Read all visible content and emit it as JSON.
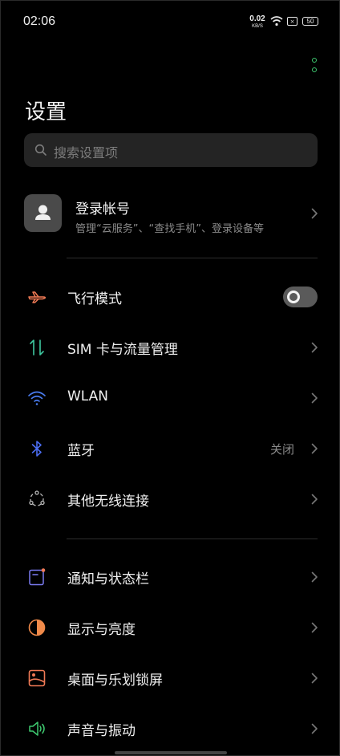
{
  "status_bar": {
    "time": "02:06",
    "net_speed": "0.02",
    "net_unit": "KB/S",
    "sim_label": "×",
    "battery": "50"
  },
  "header": {
    "title": "设置"
  },
  "search": {
    "placeholder": "搜索设置项"
  },
  "account": {
    "title": "登录帐号",
    "subtitle": "管理“云服务”、“查找手机”、登录设备等"
  },
  "sections": [
    [
      {
        "label": "飞行模式",
        "icon": "airplane-icon",
        "control": "toggle",
        "toggle_on": false
      },
      {
        "label": "SIM 卡与流量管理",
        "icon": "sim-data-icon",
        "control": "chevron"
      },
      {
        "label": "WLAN",
        "icon": "wifi-icon",
        "control": "chevron"
      },
      {
        "label": "蓝牙",
        "icon": "bluetooth-icon",
        "control": "chevron",
        "value": "关闭"
      },
      {
        "label": "其他无线连接",
        "icon": "wireless-connections-icon",
        "control": "chevron"
      }
    ],
    [
      {
        "label": "通知与状态栏",
        "icon": "notification-icon",
        "control": "chevron"
      },
      {
        "label": "显示与亮度",
        "icon": "display-brightness-icon",
        "control": "chevron"
      },
      {
        "label": "桌面与乐划锁屏",
        "icon": "wallpaper-icon",
        "control": "chevron"
      },
      {
        "label": "声音与振动",
        "icon": "sound-icon",
        "control": "chevron"
      }
    ]
  ],
  "colors": {
    "accent_green": "#3ec86f",
    "airplane": "#f07a55",
    "sim": "#3ec8a0",
    "wifi": "#4a7cf0",
    "bluetooth": "#4a6cf0",
    "notification": "#7a7af0",
    "display": "#f08a4a",
    "wallpaper": "#f07a55",
    "sound": "#3ec86f"
  }
}
